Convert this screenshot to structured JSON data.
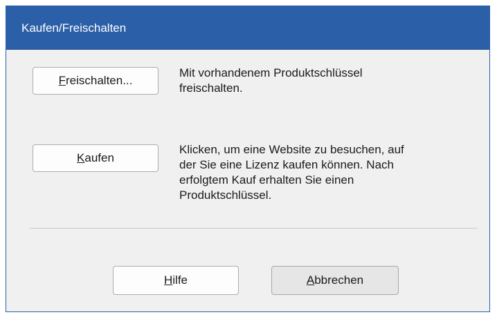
{
  "dialog": {
    "title": "Kaufen/Freischalten"
  },
  "unlock": {
    "button_mnemonic": "F",
    "button_rest": "reischalten...",
    "description_line1": "Mit vorhandenem Produktschlüssel",
    "description_line2": "freischalten."
  },
  "buy": {
    "button_mnemonic": "K",
    "button_rest": "aufen",
    "description_line1": "Klicken, um eine Website zu besuchen, auf",
    "description_line2": "der Sie eine Lizenz kaufen können. Nach",
    "description_line3": "erfolgtem Kauf erhalten Sie einen",
    "description_line4": "Produktschlüssel."
  },
  "footer": {
    "help_mnemonic": "H",
    "help_rest": "ilfe",
    "cancel_mnemonic": "A",
    "cancel_rest": "bbrechen"
  }
}
